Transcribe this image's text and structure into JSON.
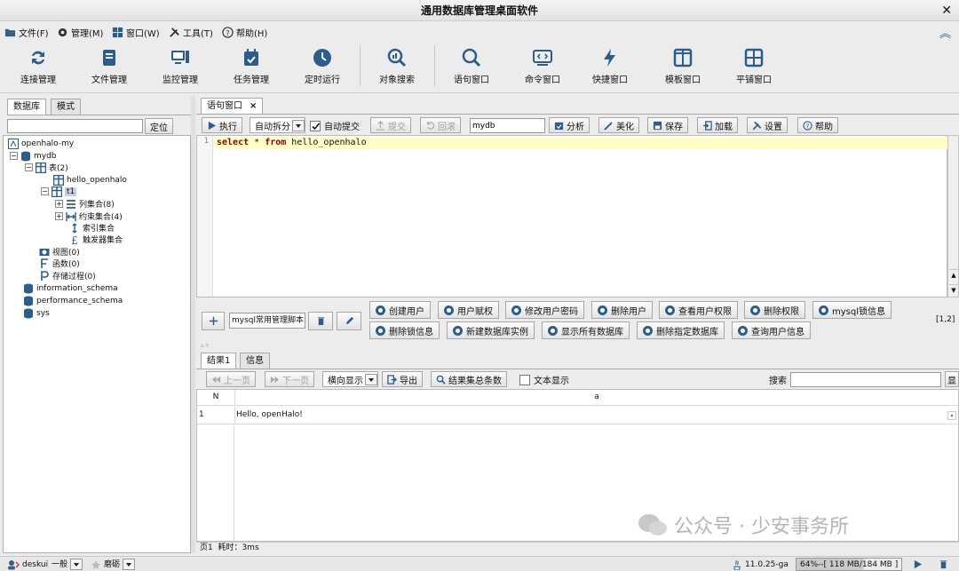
{
  "window": {
    "title": "通用数据库管理桌面软件"
  },
  "menus": [
    {
      "label": "文件(F)",
      "icon": "folder-icon"
    },
    {
      "label": "管理(M)",
      "icon": "gear-icon"
    },
    {
      "label": "窗口(W)",
      "icon": "windows-icon"
    },
    {
      "label": "工具(T)",
      "icon": "tools-icon"
    },
    {
      "label": "帮助(H)",
      "icon": "help-icon"
    }
  ],
  "toolbar": [
    {
      "label": "连接管理",
      "icon": "connect-icon"
    },
    {
      "label": "文件管理",
      "icon": "file-manage-icon"
    },
    {
      "label": "监控管理",
      "icon": "monitor-icon"
    },
    {
      "label": "任务管理",
      "icon": "task-icon"
    },
    {
      "label": "定时运行",
      "icon": "clock-icon"
    },
    {
      "label": "对象搜索",
      "icon": "object-search-icon"
    },
    {
      "label": "语句窗口",
      "icon": "search-icon"
    },
    {
      "label": "命令窗口",
      "icon": "command-window-icon"
    },
    {
      "label": "快捷窗口",
      "icon": "lightning-icon"
    },
    {
      "label": "模板窗口",
      "icon": "template-window-icon"
    },
    {
      "label": "平铺窗口",
      "icon": "tile-window-icon"
    }
  ],
  "left": {
    "tabs": [
      "数据库",
      "模式"
    ],
    "locate_button": "定位",
    "tree": [
      {
        "label": "openhalo-my"
      },
      {
        "label": "mydb"
      },
      {
        "label": "表(2)"
      },
      {
        "label": "hello_openhalo"
      },
      {
        "label": "t1"
      },
      {
        "label": "列集合(8)"
      },
      {
        "label": "约束集合(4)"
      },
      {
        "label": "索引集合"
      },
      {
        "label": "触发器集合"
      },
      {
        "label": "视图(0)"
      },
      {
        "label": "函数(0)"
      },
      {
        "label": "存储过程(0)"
      },
      {
        "label": "information_schema"
      },
      {
        "label": "performance_schema"
      },
      {
        "label": "sys"
      }
    ]
  },
  "editor": {
    "tab_label": "语句窗口",
    "tab_close": "×",
    "buttons": {
      "execute": "执行",
      "auto_split": "自动拆分",
      "auto_commit": "自动提交",
      "commit": "提交",
      "rollback": "回滚",
      "analyze": "分析",
      "beautify": "美化",
      "save": "保存",
      "load": "加载",
      "settings": "设置",
      "help": "帮助"
    },
    "database": "mydb",
    "line_number": "1",
    "sql": {
      "kw1": "select",
      "star": " * ",
      "kw2": "from",
      "rest": " hello_openhalo"
    }
  },
  "commands": {
    "script_select": "mysql常用管理脚本",
    "position": "[1,2]",
    "row1": [
      "创建用户",
      "用户赋权",
      "修改用户密码",
      "删除用户",
      "查看用户权限",
      "删除权限",
      "mysql锁信息"
    ],
    "row2": [
      "删除锁信息",
      "新建数据库实例",
      "显示所有数据库",
      "删除指定数据库",
      "查询用户信息"
    ]
  },
  "results": {
    "tabs": [
      "结果1",
      "信息"
    ],
    "prev_page": "上一页",
    "next_page": "下一页",
    "display_mode": "横向显示",
    "export": "导出",
    "total_count": "结果集总条数",
    "text_display": "文本显示",
    "search_label": "搜索",
    "search_button": "显",
    "columns": [
      "N",
      "a"
    ],
    "rows": [
      {
        "n": "1",
        "a": "Hello, openHalo!"
      }
    ],
    "status": "页1  耗时：3ms"
  },
  "bottom": {
    "user": "deskui",
    "level": "一般",
    "style": "磨砺",
    "version": "11.0.25-ga",
    "memory": "64%--[ 118 MB/184 MB ]"
  },
  "watermark": "公众号 · 少安事务所",
  "colors": {
    "accent": "#2d5d8a",
    "sql_line": "#ffffc8",
    "keyword": "#8b0000"
  }
}
